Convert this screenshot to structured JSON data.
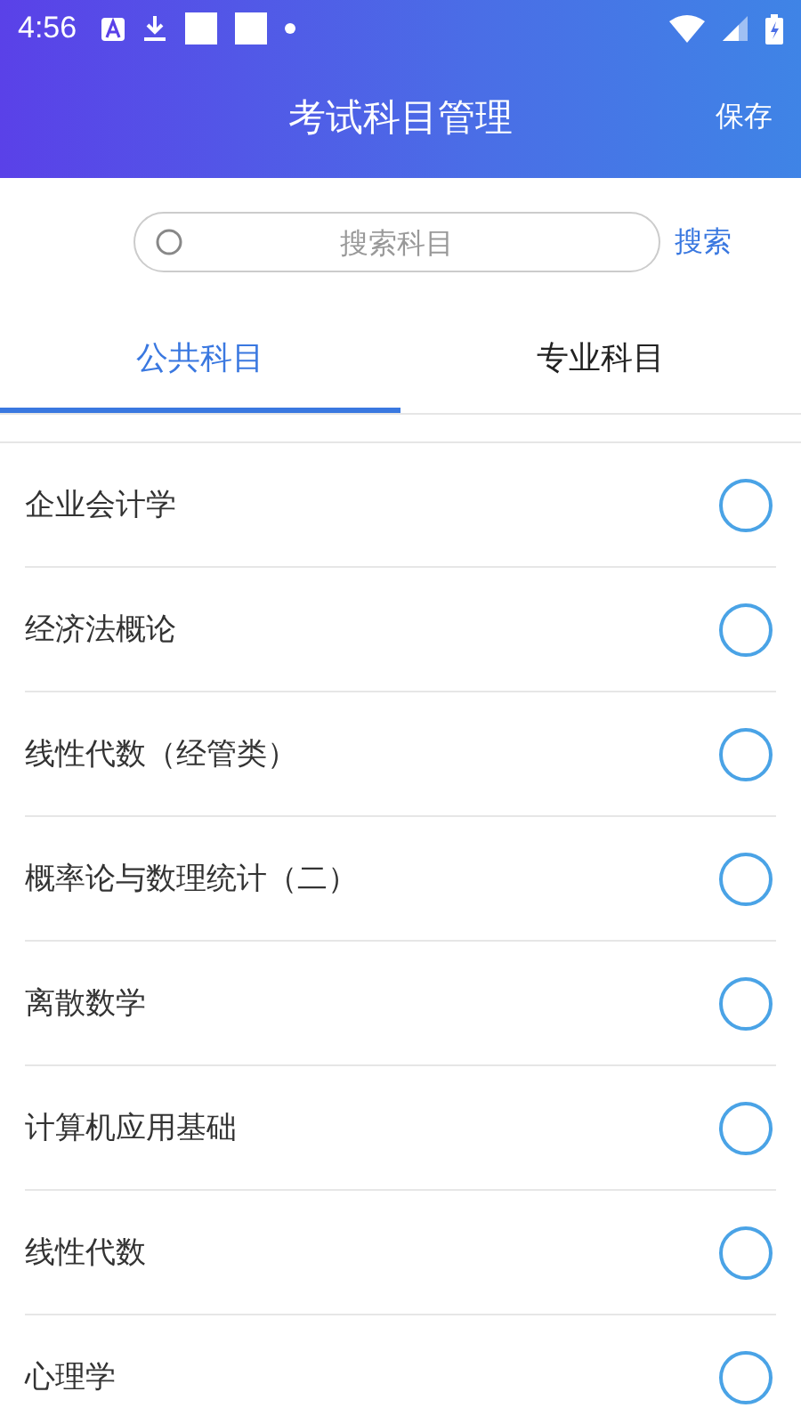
{
  "status_bar": {
    "time": "4:56"
  },
  "header": {
    "title": "考试科目管理",
    "action": "保存"
  },
  "search": {
    "placeholder": "搜索科目",
    "button": "搜索"
  },
  "tabs": [
    {
      "label": "公共科目",
      "selected": true
    },
    {
      "label": "专业科目",
      "selected": false
    }
  ],
  "subjects": [
    {
      "name": "企业会计学",
      "selected": false
    },
    {
      "name": "经济法概论",
      "selected": false
    },
    {
      "name": "线性代数（经管类）",
      "selected": false
    },
    {
      "name": "概率论与数理统计（二）",
      "selected": false
    },
    {
      "name": "离散数学",
      "selected": false
    },
    {
      "name": "计算机应用基础",
      "selected": false
    },
    {
      "name": "线性代数",
      "selected": false
    },
    {
      "name": "心理学",
      "selected": false
    }
  ]
}
